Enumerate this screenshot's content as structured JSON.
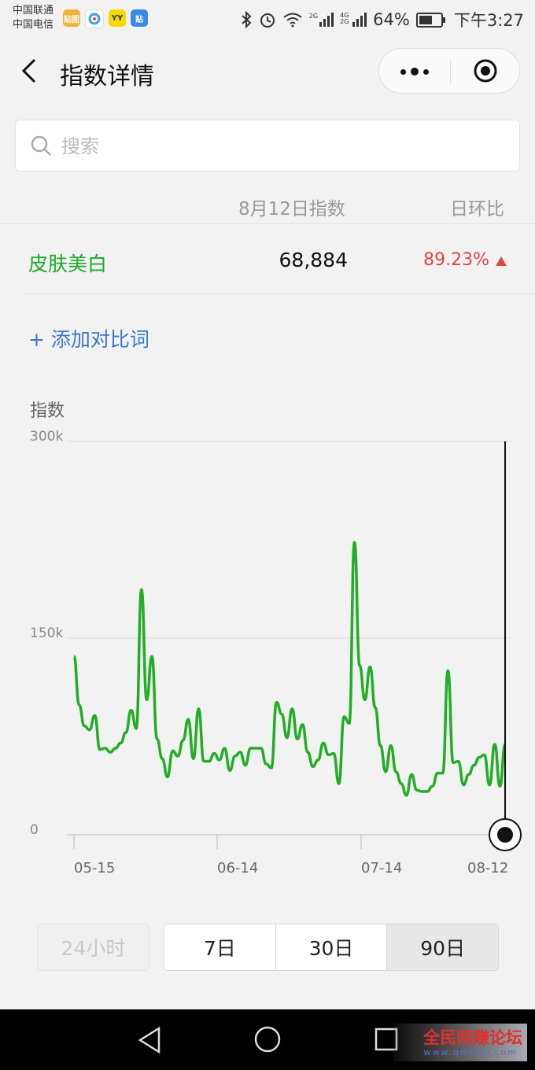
{
  "status_bar": {
    "carrier1": "中国联通",
    "carrier2": "中国电信",
    "app_icons": [
      "贴图",
      "YY",
      "贴"
    ],
    "network1": "2G",
    "network2": "4G 2G",
    "battery": "64%",
    "battery_level": 0.64,
    "time": "下午3:27"
  },
  "header": {
    "title": "指数详情",
    "more_icon": "more-dots-icon",
    "close_icon": "target-circle-icon"
  },
  "search": {
    "placeholder": "搜索",
    "value": ""
  },
  "table": {
    "col_index": "8月12日指数",
    "col_change": "日环比",
    "rows": [
      {
        "term": "皮肤美白",
        "value": "68,884",
        "change": "89.23%",
        "direction": "up"
      }
    ]
  },
  "add_compare": "+ 添加对比词",
  "chart_data": {
    "type": "line",
    "ylabel": "指数",
    "ylim": [
      0,
      300000
    ],
    "y_ticks": [
      "300k",
      "150k",
      "0"
    ],
    "x_ticks": [
      "05-15",
      "06-14",
      "07-14",
      "08-12"
    ],
    "grid": true,
    "series": [
      {
        "color": "#22ad26",
        "x_start": "05-15",
        "x_end": "08-12",
        "values": [
          136000,
          99000,
          83000,
          80000,
          91000,
          65000,
          66000,
          63000,
          66000,
          70000,
          78000,
          95000,
          81000,
          187000,
          103000,
          136000,
          73000,
          58000,
          44000,
          64000,
          60000,
          72000,
          88000,
          58000,
          96000,
          56000,
          56000,
          62000,
          57000,
          66000,
          49000,
          60000,
          63000,
          53000,
          66000,
          66000,
          66000,
          54000,
          51000,
          101000,
          92000,
          74000,
          96000,
          73000,
          84000,
          63000,
          52000,
          57000,
          70000,
          61000,
          62000,
          39000,
          90000,
          85000,
          223000,
          129000,
          103000,
          128000,
          97000,
          68000,
          48000,
          68000,
          48000,
          39000,
          30000,
          46000,
          34000,
          33000,
          33000,
          37000,
          47000,
          47000,
          125000,
          55000,
          56000,
          38000,
          46000,
          53000,
          59000,
          61000,
          38000,
          69000,
          37000,
          68884
        ]
      }
    ],
    "highlight": {
      "x": "08-12",
      "value": 68884
    }
  },
  "range_buttons": {
    "h24": "24小时",
    "d7": "7日",
    "d30": "30日",
    "d90": "90日",
    "selected": "90日"
  },
  "watermark": {
    "line1": "全民网赚论坛",
    "line2": "www.qmceo.com"
  }
}
